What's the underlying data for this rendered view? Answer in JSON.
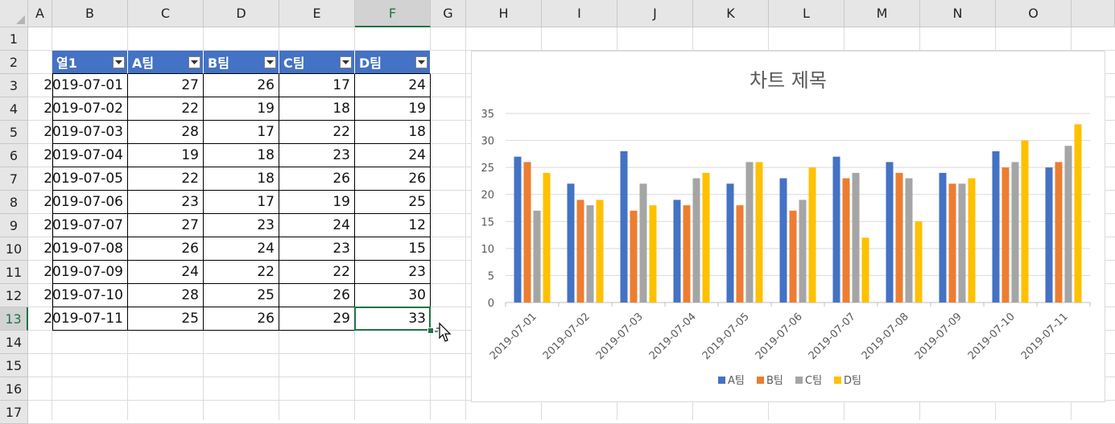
{
  "columns": [
    "A",
    "B",
    "C",
    "D",
    "E",
    "F",
    "G",
    "H",
    "I",
    "J",
    "K",
    "L",
    "M",
    "N",
    "O"
  ],
  "rows": [
    "1",
    "2",
    "3",
    "4",
    "5",
    "6",
    "7",
    "8",
    "9",
    "10",
    "11",
    "12",
    "13",
    "14",
    "15",
    "16",
    "17"
  ],
  "selected_column": "F",
  "selected_row": "13",
  "table": {
    "headers": [
      "열1",
      "A팀",
      "B팀",
      "C팀",
      "D팀"
    ],
    "rows": [
      [
        "2019-07-01",
        "27",
        "26",
        "17",
        "24"
      ],
      [
        "2019-07-02",
        "22",
        "19",
        "18",
        "19"
      ],
      [
        "2019-07-03",
        "28",
        "17",
        "22",
        "18"
      ],
      [
        "2019-07-04",
        "19",
        "18",
        "23",
        "24"
      ],
      [
        "2019-07-05",
        "22",
        "18",
        "26",
        "26"
      ],
      [
        "2019-07-06",
        "23",
        "17",
        "19",
        "25"
      ],
      [
        "2019-07-07",
        "27",
        "23",
        "24",
        "12"
      ],
      [
        "2019-07-08",
        "26",
        "24",
        "23",
        "15"
      ],
      [
        "2019-07-09",
        "24",
        "22",
        "22",
        "23"
      ],
      [
        "2019-07-10",
        "28",
        "25",
        "26",
        "30"
      ],
      [
        "2019-07-11",
        "25",
        "26",
        "29",
        "33"
      ]
    ]
  },
  "chart_data": {
    "type": "bar",
    "title": "차트 제목",
    "categories": [
      "2019-07-01",
      "2019-07-02",
      "2019-07-03",
      "2019-07-04",
      "2019-07-05",
      "2019-07-06",
      "2019-07-07",
      "2019-07-08",
      "2019-07-09",
      "2019-07-10",
      "2019-07-11"
    ],
    "series": [
      {
        "name": "A팀",
        "color": "#4472c4",
        "values": [
          27,
          22,
          28,
          19,
          22,
          23,
          27,
          26,
          24,
          28,
          25
        ]
      },
      {
        "name": "B팀",
        "color": "#ed7d31",
        "values": [
          26,
          19,
          17,
          18,
          18,
          17,
          23,
          24,
          22,
          25,
          26
        ]
      },
      {
        "name": "C팀",
        "color": "#a5a5a5",
        "values": [
          17,
          18,
          22,
          23,
          26,
          19,
          24,
          23,
          22,
          26,
          29
        ]
      },
      {
        "name": "D팀",
        "color": "#ffc000",
        "values": [
          24,
          19,
          18,
          24,
          26,
          25,
          12,
          15,
          23,
          30,
          33
        ]
      }
    ],
    "yticks": [
      "0",
      "5",
      "10",
      "15",
      "20",
      "25",
      "30",
      "35"
    ],
    "ylim": [
      0,
      35
    ],
    "grid": true,
    "legend": "bottom",
    "xlabel": "",
    "ylabel": ""
  }
}
